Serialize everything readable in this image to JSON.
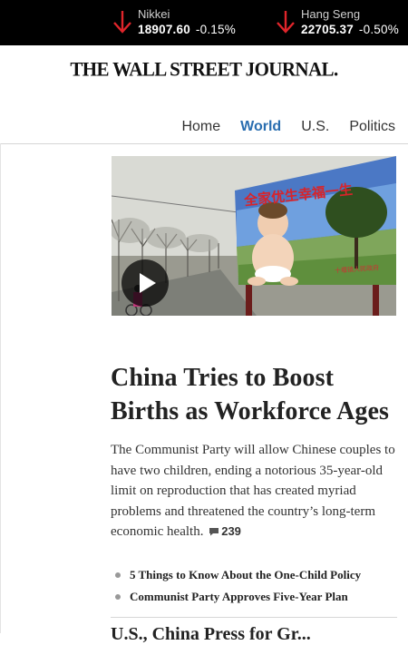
{
  "ticker": [
    {
      "name": "Nikkei",
      "value": "18907.60",
      "change": "-0.15%",
      "direction": "down"
    },
    {
      "name": "Hang Seng",
      "value": "22705.37",
      "change": "-0.50%",
      "direction": "down"
    }
  ],
  "masthead": "THE WALL STREET JOURNAL.",
  "nav": {
    "home": "Home",
    "world": "World",
    "us": "U.S.",
    "politics": "Politics"
  },
  "article": {
    "image": {
      "billboard_text": "全家优生幸福一生",
      "billboard_small": "十堰镇人民政府"
    },
    "headline": "China Tries to Boost Births as Workforce Ages",
    "summary": "The Communist Party will allow Chinese couples to have two children, ending a notorious 35-year-old limit on reproduction that has created myriad problems and threatened the country’s long-term economic health.",
    "comment_count": "239",
    "related": [
      "5 Things to Know About the One-Child Policy",
      "Communist Party Approves Five-Year Plan"
    ]
  },
  "next_headline": "U.S., China Press for Gr...",
  "colors": {
    "ticker_down": "#e0252b",
    "nav_active": "#2a6eb0"
  }
}
